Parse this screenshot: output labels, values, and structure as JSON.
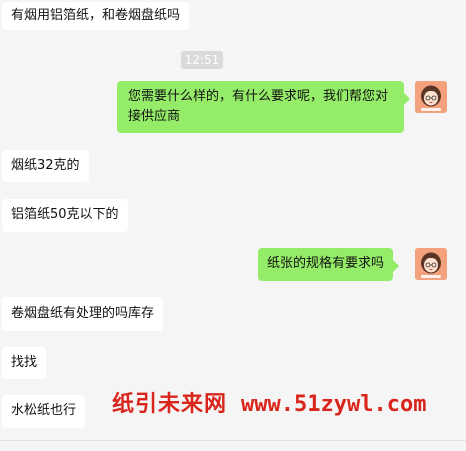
{
  "chat": {
    "messages": [
      {
        "side": "in",
        "text": "有烟用铝箔纸，和卷烟盘纸吗"
      },
      {
        "side": "out",
        "text": "您需要什么样的，有什么要求呢，我们帮您对接供应商"
      },
      {
        "side": "in",
        "text": "烟纸32克的"
      },
      {
        "side": "in",
        "text": "铝箔纸50克以下的"
      },
      {
        "side": "out",
        "text": "纸张的规格有要求吗"
      },
      {
        "side": "in",
        "text": "卷烟盘纸有处理的吗库存"
      },
      {
        "side": "in",
        "text": "找找"
      },
      {
        "side": "in",
        "text": "水松纸也行"
      }
    ],
    "timestamp": "12:51",
    "avatar_icon": "girl-avatar-icon"
  },
  "watermark": {
    "brand": "纸引未来网",
    "url": "www.51zywl.com"
  },
  "colors": {
    "background": "#f5f5f5",
    "incoming_bubble": "#ffffff",
    "outgoing_bubble": "#95ec69",
    "watermark": "#d9261c",
    "avatar_bg": "#f4a27d"
  }
}
